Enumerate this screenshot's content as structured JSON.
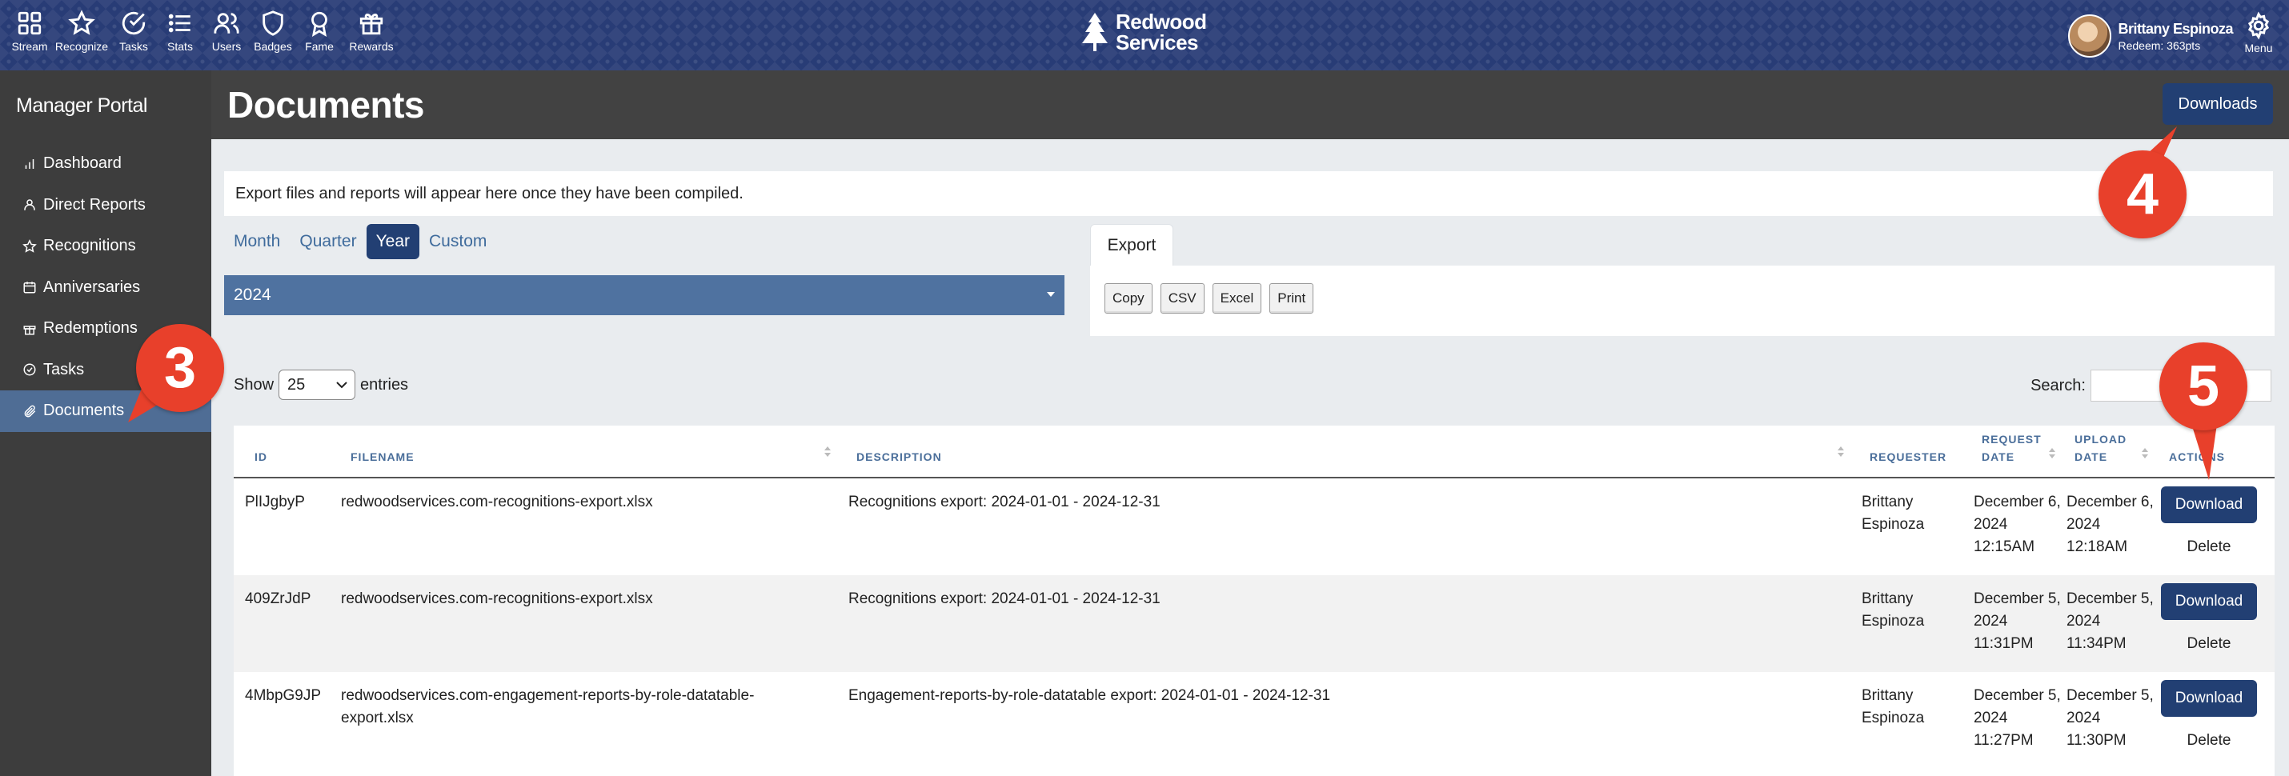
{
  "topnav": {
    "items": [
      {
        "label": "Stream",
        "icon": "grid-icon"
      },
      {
        "label": "Recognize",
        "icon": "star-icon"
      },
      {
        "label": "Tasks",
        "icon": "check-circle-icon"
      },
      {
        "label": "Stats",
        "icon": "list-icon"
      },
      {
        "label": "Users",
        "icon": "users-icon"
      },
      {
        "label": "Badges",
        "icon": "shield-icon"
      },
      {
        "label": "Fame",
        "icon": "award-icon"
      },
      {
        "label": "Rewards",
        "icon": "gift-icon"
      }
    ],
    "brand_line1": "Redwood",
    "brand_line2": "Services",
    "user_name": "Brittany Espinoza",
    "user_points": "Redeem: 363pts",
    "menu_label": "Menu"
  },
  "sidebar": {
    "title": "Manager Portal",
    "items": [
      {
        "label": "Dashboard",
        "icon": "bar-chart-icon"
      },
      {
        "label": "Direct Reports",
        "icon": "user-icon"
      },
      {
        "label": "Recognitions",
        "icon": "star-icon"
      },
      {
        "label": "Anniversaries",
        "icon": "calendar-icon"
      },
      {
        "label": "Redemptions",
        "icon": "gift-icon"
      },
      {
        "label": "Tasks",
        "icon": "check-circle-icon"
      },
      {
        "label": "Documents",
        "icon": "paperclip-icon"
      }
    ],
    "active": "Documents"
  },
  "header": {
    "title": "Documents",
    "downloads_label": "Downloads"
  },
  "info_text": "Export files and reports will appear here once they have been compiled.",
  "period_tabs": [
    "Month",
    "Quarter",
    "Year",
    "Custom"
  ],
  "active_period": "Year",
  "year_value": "2024",
  "export": {
    "tab_label": "Export",
    "buttons": [
      "Copy",
      "CSV",
      "Excel",
      "Print"
    ]
  },
  "show_entries": {
    "prefix": "Show",
    "value": "25",
    "suffix": "entries"
  },
  "search_label": "Search:",
  "table": {
    "headers": {
      "id": "ID",
      "filename": "FILENAME",
      "description": "DESCRIPTION",
      "requester": "REQUESTER",
      "request_date": "REQUEST DATE",
      "upload_date": "UPLOAD DATE",
      "actions": "ACTIONS"
    },
    "rows": [
      {
        "id": "PlIJgbyP",
        "filename": "redwoodservices.com-recognitions-export.xlsx",
        "description": "Recognitions export: 2024-01-01 - 2024-12-31",
        "requester": "Brittany Espinoza",
        "request_date": "December 6, 2024 12:15AM",
        "upload_date": "December 6, 2024 12:18AM",
        "download_label": "Download",
        "delete_label": "Delete"
      },
      {
        "id": "409ZrJdP",
        "filename": "redwoodservices.com-recognitions-export.xlsx",
        "description": "Recognitions export: 2024-01-01 - 2024-12-31",
        "requester": "Brittany Espinoza",
        "request_date": "December 5, 2024 11:31PM",
        "upload_date": "December 5, 2024 11:34PM",
        "download_label": "Download",
        "delete_label": "Delete"
      },
      {
        "id": "4MbpG9JP",
        "filename": "redwoodservices.com-engagement-reports-by-role-datatable-export.xlsx",
        "description": "Engagement-reports-by-role-datatable export: 2024-01-01 - 2024-12-31",
        "requester": "Brittany Espinoza",
        "request_date": "December 5, 2024 11:27PM",
        "upload_date": "December 5, 2024 11:30PM",
        "download_label": "Download",
        "delete_label": "Delete"
      }
    ]
  },
  "callouts": [
    "3",
    "4",
    "5"
  ],
  "colors": {
    "nav_bg": "#283c76",
    "sidebar_bg": "#3d3d3d",
    "sidebar_active": "#4f6d95",
    "primary_button": "#223f73",
    "callout": "#e8402b"
  }
}
